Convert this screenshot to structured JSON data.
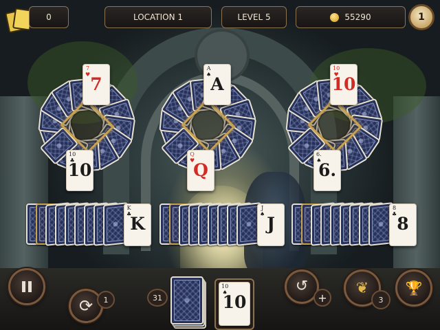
{
  "header": {
    "moves": "0",
    "location": "LOCATION 1",
    "level": "LEVEL 5",
    "coins": "55290",
    "hint_count": "1"
  },
  "tableau": [
    {
      "top_rank": "7",
      "top_suit": "♥",
      "top_color": "red",
      "bottom_rank": "10",
      "bottom_suit": "♣",
      "bottom_color": "black"
    },
    {
      "top_rank": "A",
      "top_suit": "♠",
      "top_color": "black",
      "bottom_rank": "Q",
      "bottom_suit": "♥",
      "bottom_color": "red"
    },
    {
      "top_rank": "10",
      "top_suit": "♥",
      "top_color": "red",
      "bottom_rank": "6.",
      "bottom_suit": "♠",
      "bottom_color": "black"
    }
  ],
  "rows": [
    {
      "rank": "K",
      "suit": "♣"
    },
    {
      "rank": "J",
      "suit": "♠"
    },
    {
      "rank": "8",
      "suit": "♣"
    }
  ],
  "bottom": {
    "stock_count": "31",
    "waste_rank": "10",
    "waste_suit": "♠",
    "shuffle_count": "1",
    "butterfly_count": "3"
  },
  "icons": {
    "pause": "pause-icon",
    "shuffle": "shuffle-icon",
    "undo": "undo-icon",
    "add": "plus-icon",
    "butterfly": "butterfly-icon",
    "trophy": "trophy-icon",
    "deck": "cards-icon",
    "coin": "coin-icon"
  },
  "colors": {
    "accent_gold": "#c9a24a",
    "card_red": "#d42a24",
    "card_back": "#27325a"
  }
}
